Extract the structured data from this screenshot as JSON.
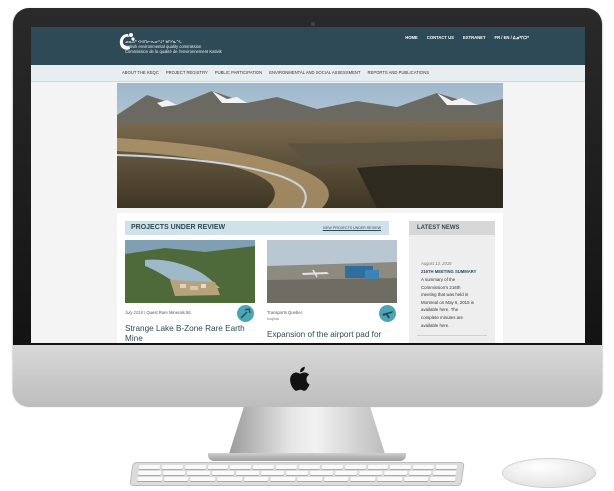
{
  "site": {
    "logo_lines": [
      "ᓄᓇᕕᒃ ᐊᕙᑎᓕᕆᓂᕐᒧᑦ ᑲᒥᓯᓇᖓ",
      "Kativik environmental quality commission",
      "Commission de la qualité de l'environnement Kativik"
    ],
    "top_nav": [
      "HOME",
      "CONTACT US",
      "EXTRANET",
      "FR / EN / ᐃᓄᒃᑎᑐᑦ"
    ],
    "main_nav": [
      "ABOUT THE KEQC",
      "PROJECT REGISTRY",
      "PUBLIC PARTICIPATION",
      "ENVIRONMENTAL AND SOCIAL ASSESSMENT",
      "REPORTS AND PUBLICATIONS"
    ]
  },
  "projects": {
    "title": "PROJECTS UNDER REVIEW",
    "view_link": "VIEW PROJECTS UNDER REVIEW",
    "cards": [
      {
        "date": "July 2018",
        "proponent": "Quest Rare Minerals ltd.",
        "sub": "",
        "title_lines": [
          "Strange Lake B-Zone Rare Earth",
          "Mine"
        ],
        "icon": "mining-icon"
      },
      {
        "date": "",
        "proponent": "Transports Quebec",
        "sub": "Ivujivik",
        "title_lines": [
          "Expansion of the airport pad for"
        ],
        "icon": "airplane-icon"
      }
    ]
  },
  "news": {
    "title": "LATEST NEWS",
    "date": "August 13, 2015",
    "headline": "216TH MEETING SUMMARY",
    "body_lines": [
      "A summary of the",
      "Commission's 216th",
      "meeting that was held in",
      "Montreal on May 6, 2015 is",
      "available here. The",
      "complete minutes are",
      "available here."
    ]
  },
  "colors": {
    "header": "#2f4a57",
    "nav": "#e6eef1",
    "accent": "#4aa6b5",
    "section_header": "#cfe2ea"
  }
}
